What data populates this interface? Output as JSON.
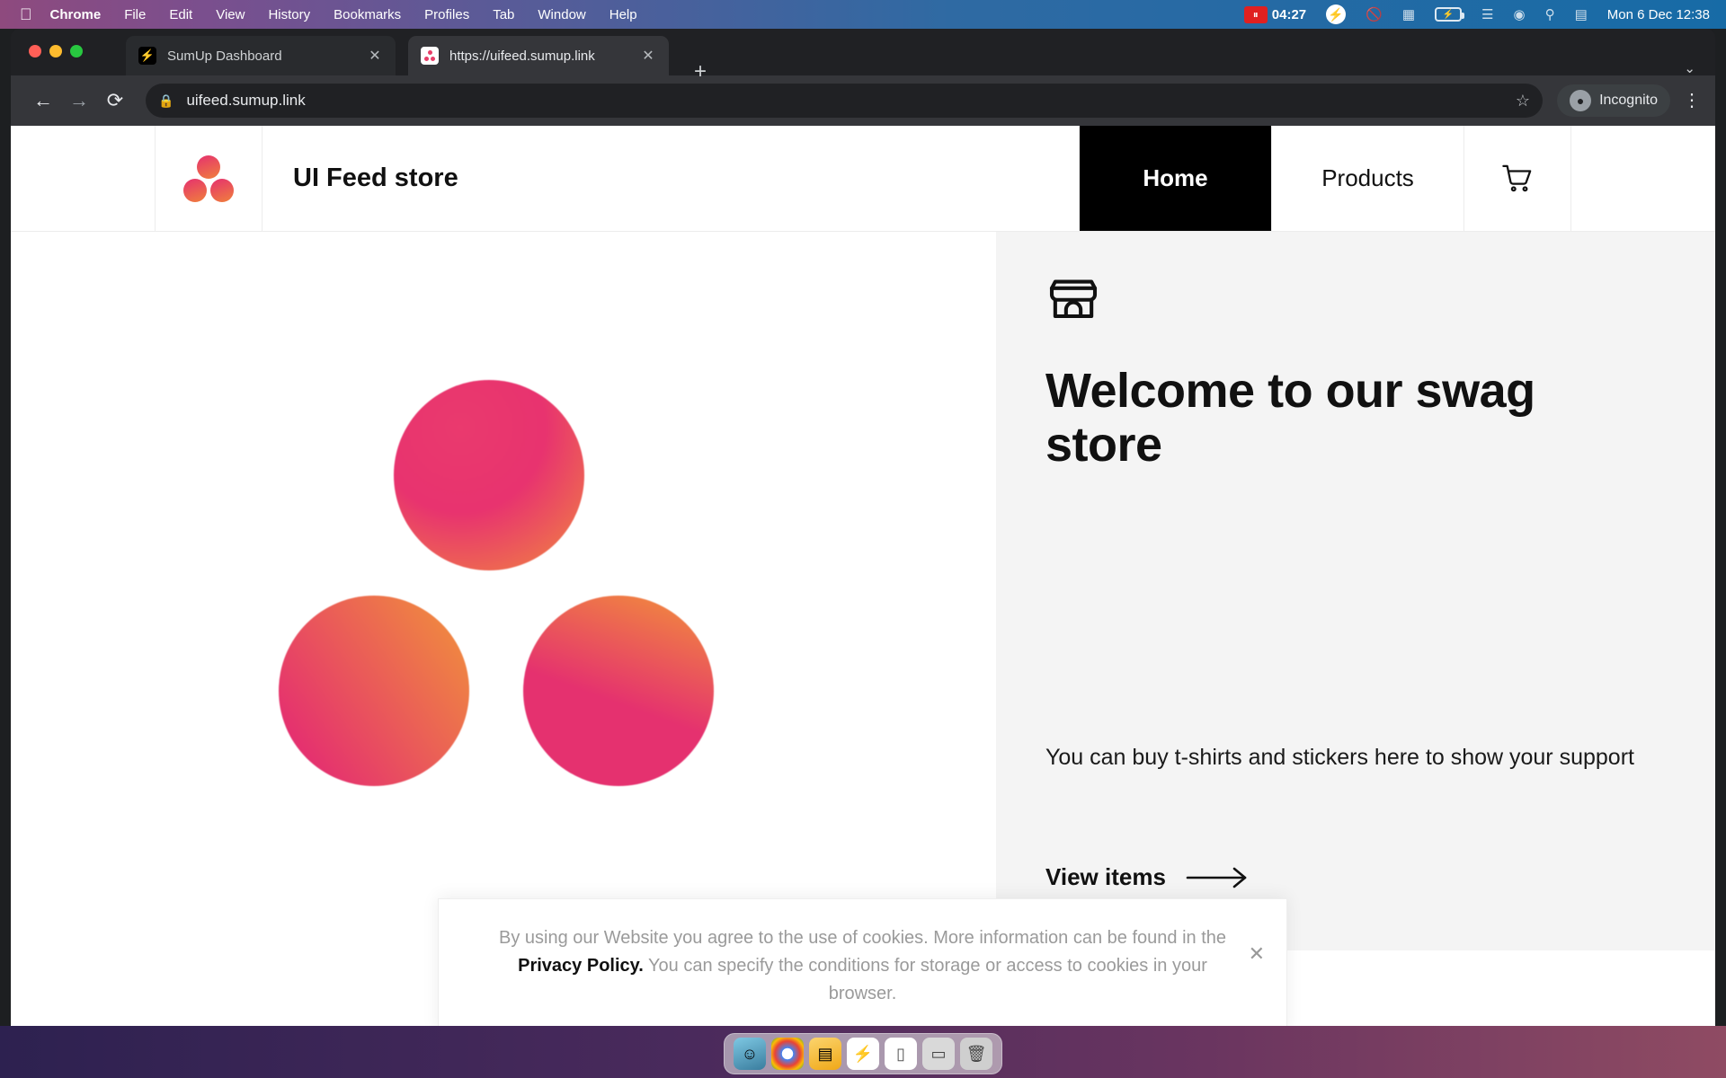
{
  "menubar": {
    "apple_icon": "apple-icon",
    "items": [
      "Chrome",
      "File",
      "Edit",
      "View",
      "History",
      "Bookmarks",
      "Profiles",
      "Tab",
      "Window",
      "Help"
    ],
    "app_name": "Chrome",
    "recording_time": "04:27",
    "status_icons": [
      "screen-recording-icon",
      "bolt-icon",
      "do-not-disturb-icon",
      "control-center-icon",
      "battery-charging-icon",
      "wifi-icon",
      "user-account-icon",
      "search-icon",
      "control-center-icon"
    ],
    "battery_glyph": "⚡",
    "clock": "Mon 6 Dec 12:38"
  },
  "browser": {
    "tabs": [
      {
        "title": "SumUp Dashboard",
        "favicon": "sumup-favicon",
        "active": false,
        "close": "✕"
      },
      {
        "title": "https://uifeed.sumup.link",
        "favicon": "uifeed-store-favicon",
        "active": true,
        "close": "✕"
      }
    ],
    "new_tab_label": "+",
    "tab_list_chevron": "⌄",
    "back_label": "←",
    "forward_label": "→",
    "reload_label": "⟳",
    "url": "uifeed.sumup.link",
    "lock_icon": "lock-icon",
    "bookmark_star": "☆",
    "incognito_label": "Incognito",
    "kebab_label": "⋮"
  },
  "site": {
    "brand_name": "UI Feed store",
    "nav": [
      {
        "label": "Home",
        "active": true
      },
      {
        "label": "Products",
        "active": false
      }
    ],
    "cart_icon": "shopping-cart-icon",
    "hero": {
      "store_icon": "storefront-icon",
      "title": "Welcome to our swag store",
      "subtitle": "You can buy t-shirts and stickers here to show your support",
      "cta_label": "View items",
      "cta_arrow": "arrow-right-icon"
    }
  },
  "cookie_banner": {
    "text_before": "By using our Website you agree to the use of cookies. More information can be found in the ",
    "link_text": "Privacy Policy.",
    "text_after": " You can specify the conditions for storage or access to cookies in your browser.",
    "close_label": "✕"
  },
  "dock": {
    "items": [
      "finder-icon",
      "chrome-icon",
      "files-icon",
      "thunderbolt-icon",
      "notes-icon",
      "terminal-icon",
      "trash-icon"
    ],
    "glyphs": [
      "☺",
      "",
      "▤",
      "⚡",
      "▯",
      "▭",
      "🗑"
    ]
  },
  "colors": {
    "brand_pink": "#e5316f",
    "brand_orange": "#f2913a",
    "nav_active_bg": "#000000",
    "hero_panel_bg": "#f4f4f4"
  }
}
